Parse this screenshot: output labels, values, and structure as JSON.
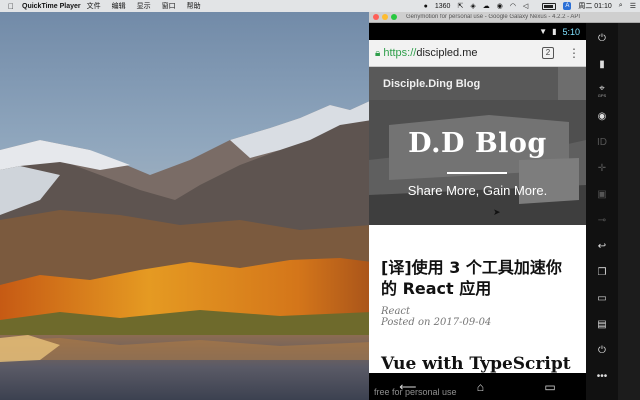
{
  "menubar": {
    "app_name": "QuickTime Player",
    "menus": [
      "文件",
      "编辑",
      "显示",
      "窗口",
      "帮助"
    ],
    "status": {
      "counter": "1360",
      "counter_badge": "A",
      "clock": "周二 01:10"
    }
  },
  "emulator": {
    "window_title": "Genymotion for personal use - Google Galaxy Nexus - 4.2.2 - API",
    "traffic_light_colors": [
      "#ff5f57",
      "#febc2e",
      "#28c840"
    ],
    "statusbar": {
      "time": "5:10"
    },
    "browser": {
      "url_scheme": "https://",
      "url_host": "discipled.me",
      "tab_count": "2"
    },
    "blog": {
      "nav_title": "Disciple.Ding Blog",
      "hero_title": "D.D Blog",
      "hero_subtitle": "Share More, Gain More.",
      "posts": [
        {
          "title": "[译]使用 3 个工具加速你的 React 应用",
          "tag": "React",
          "posted": "Posted on 2017-09-04"
        },
        {
          "title": "Vue with TypeScript"
        }
      ]
    },
    "toolbar": [
      {
        "icon": "power-icon",
        "label": ""
      },
      {
        "icon": "battery-icon",
        "label": ""
      },
      {
        "icon": "gps-icon",
        "label": "GPS"
      },
      {
        "icon": "webcam-icon",
        "label": ""
      },
      {
        "icon": "identifiers-icon",
        "label": ""
      },
      {
        "icon": "dpad-icon",
        "label": ""
      },
      {
        "icon": "media-icon",
        "label": ""
      },
      {
        "icon": "network-icon",
        "label": ""
      },
      {
        "icon": "back-icon",
        "label": ""
      },
      {
        "icon": "recent-apps-icon",
        "label": ""
      },
      {
        "icon": "home-icon",
        "label": ""
      },
      {
        "icon": "menu-icon",
        "label": ""
      },
      {
        "icon": "power-button-icon",
        "label": ""
      },
      {
        "icon": "more-icon",
        "label": ""
      }
    ],
    "watermark": "free for personal use"
  },
  "colors": {
    "url_green": "#2e9e4a",
    "status_time": "#7fe0ff",
    "blog_nav_bg": "#595959"
  }
}
